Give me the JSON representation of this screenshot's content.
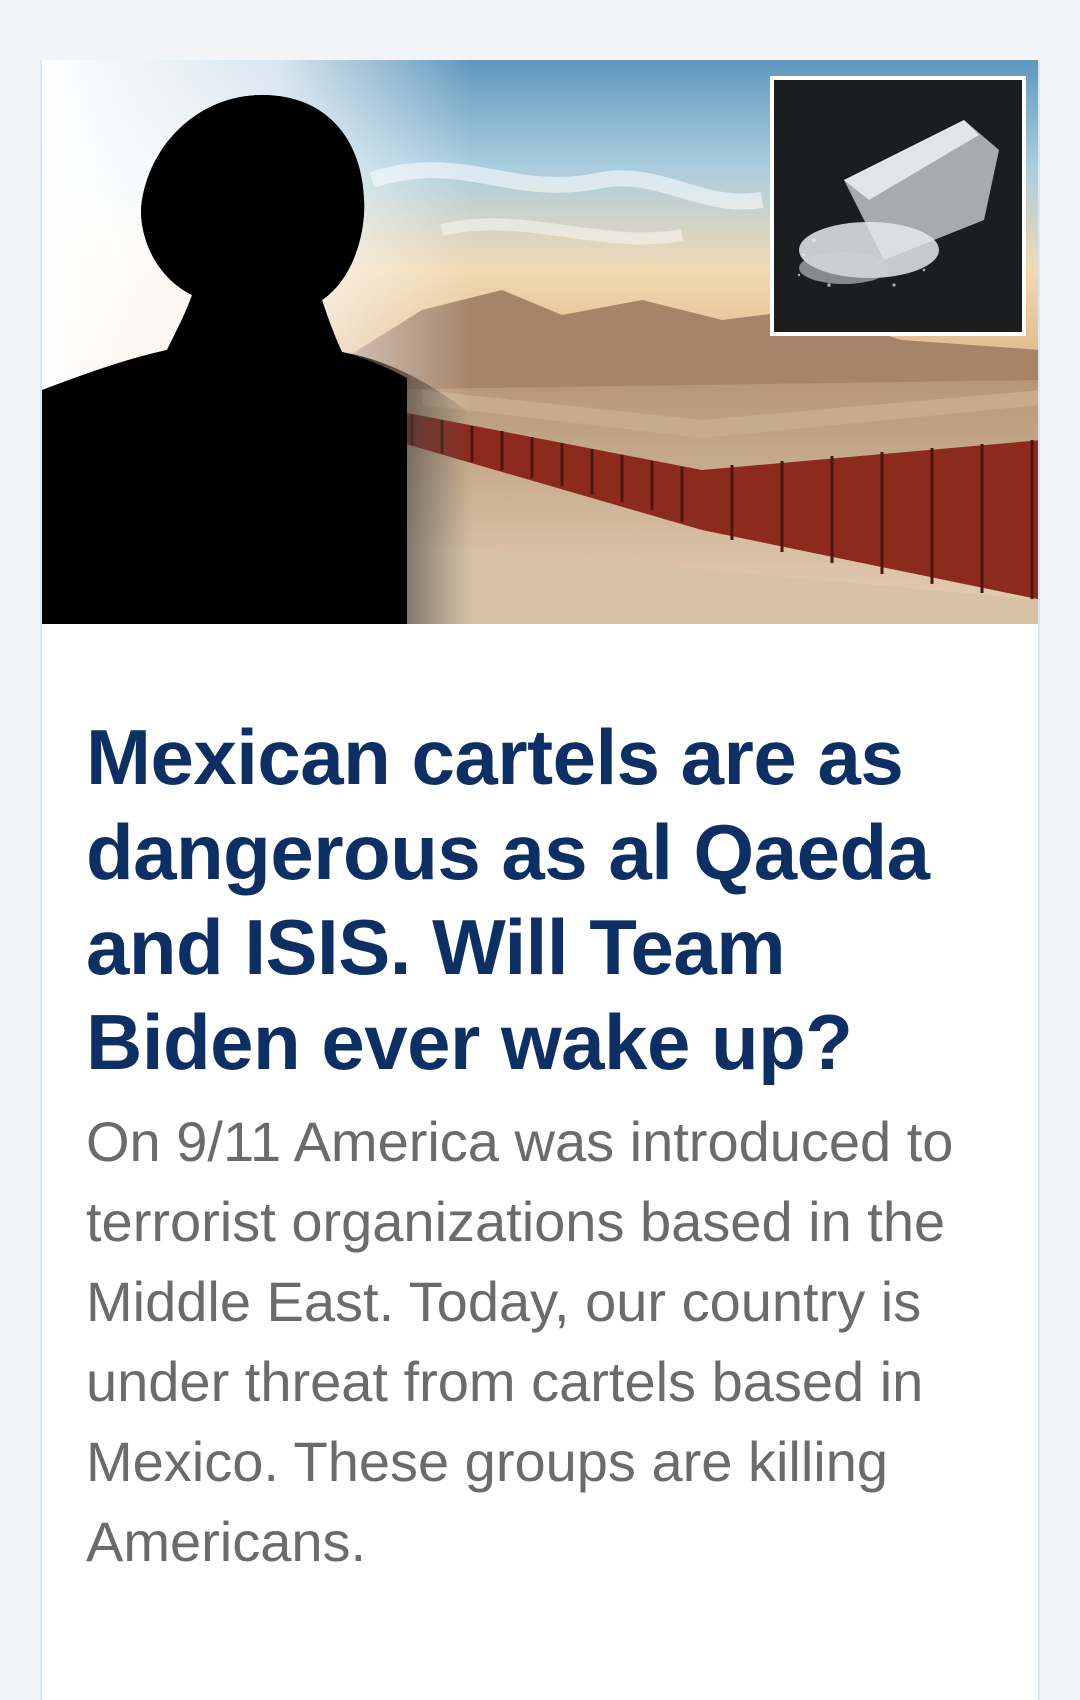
{
  "article": {
    "headline": "Mexican cartels are as dangerous as al Qaeda and ISIS. Will Team Biden ever wake up?",
    "summary": "On 9/11 America was introduced to terrorist organizations based in the Middle East. Today, our country is under threat from cartels based in Mexico. These groups are killing Americans."
  },
  "colors": {
    "page_background": "#f2f4f7",
    "card_background": "#ffffff",
    "card_border": "#dbe6f3",
    "headline": "#0d2f63",
    "summary": "#6b6b6b"
  }
}
